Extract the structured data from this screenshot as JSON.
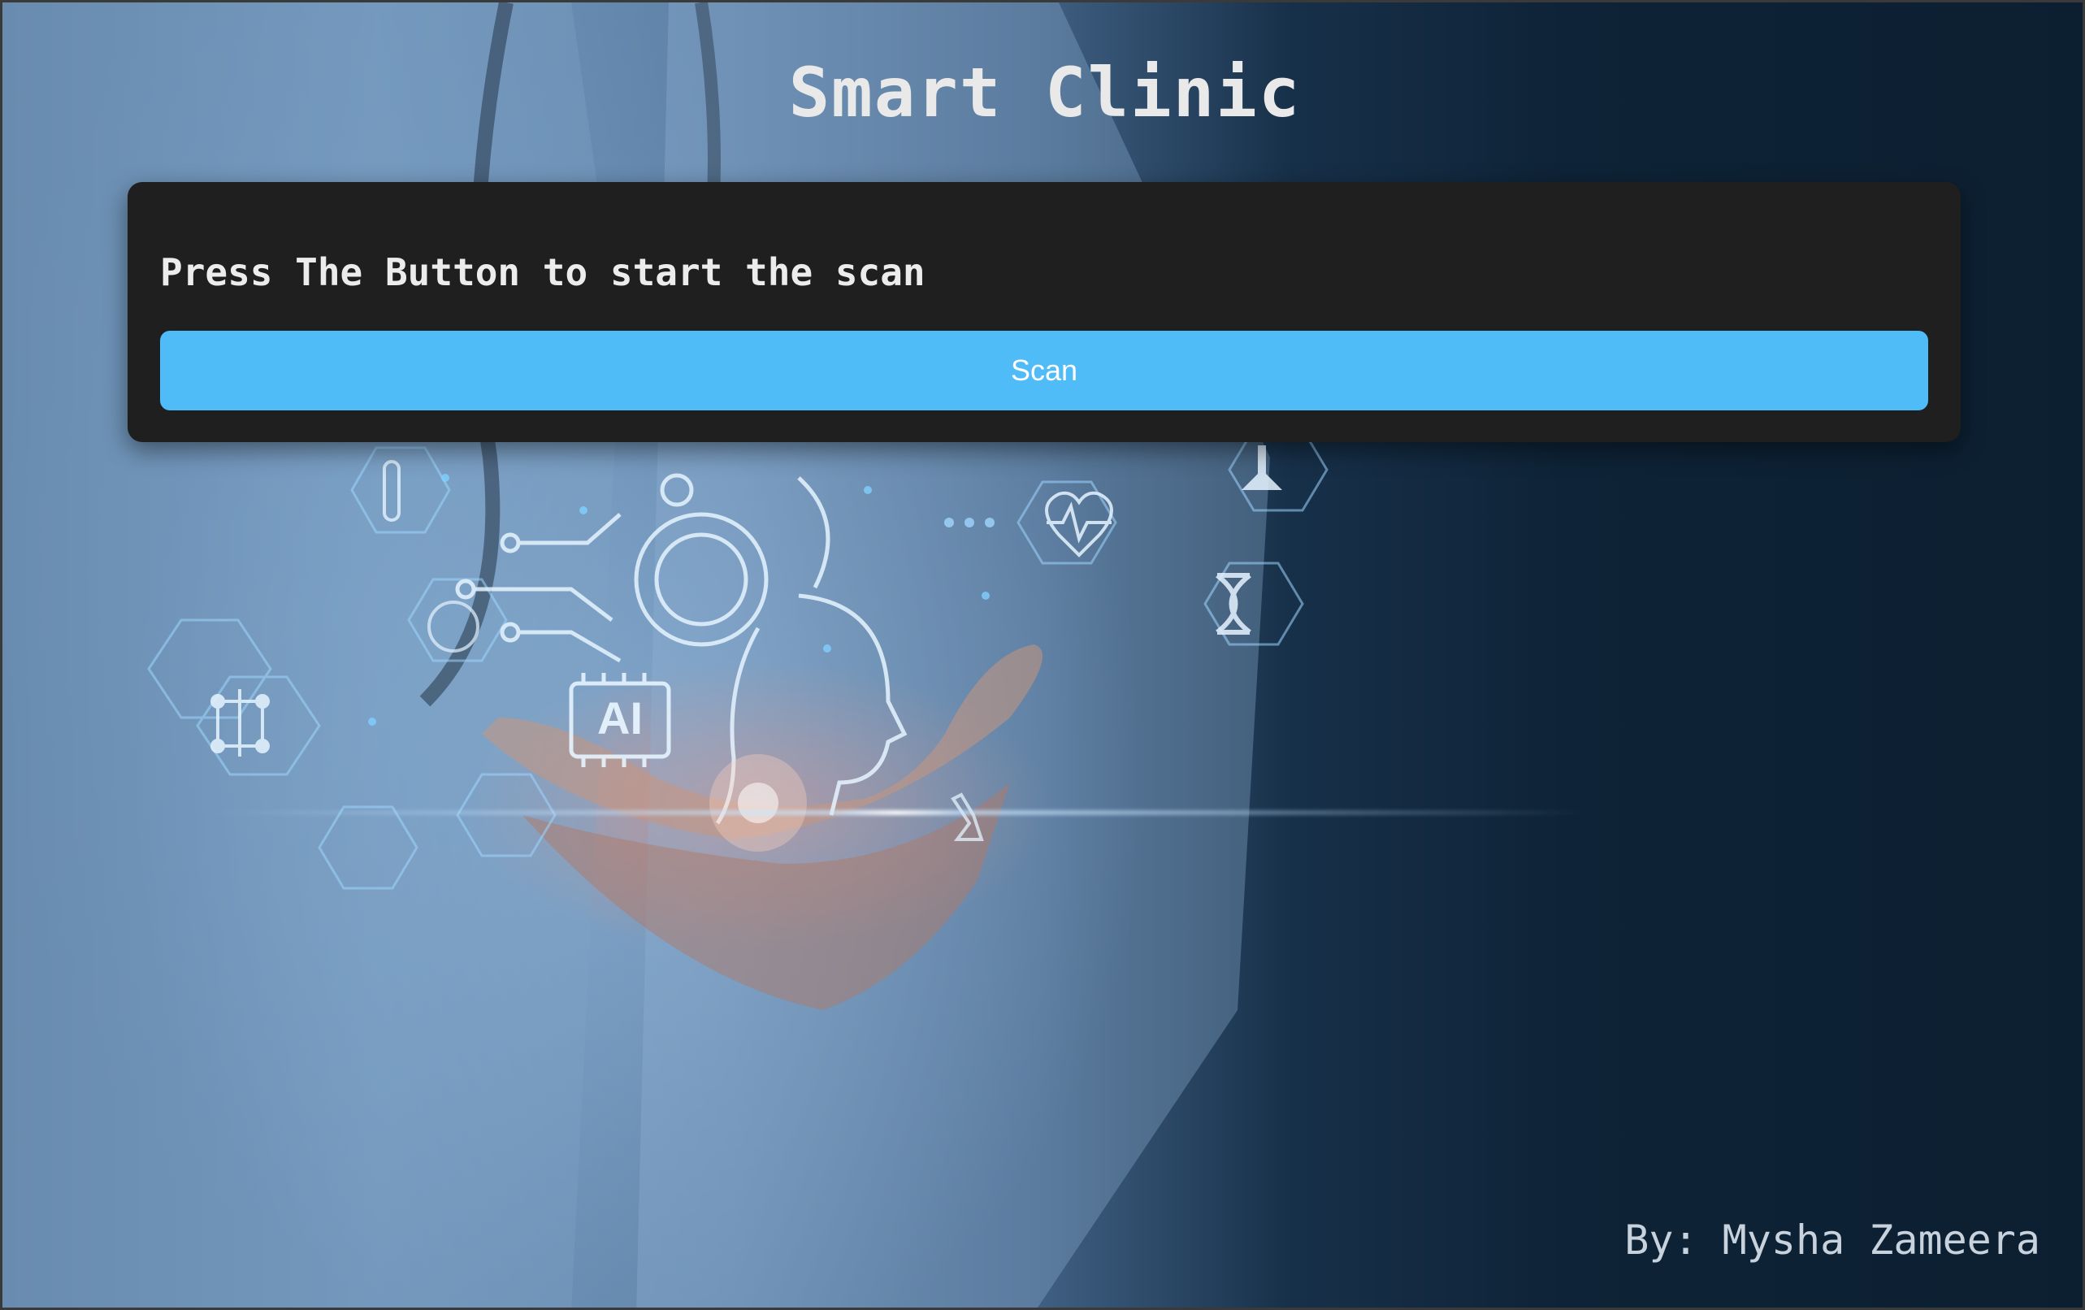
{
  "header": {
    "title": "Smart Clinic"
  },
  "scan_card": {
    "prompt": "Press The Button to start the scan",
    "button_label": "Scan"
  },
  "footer": {
    "author": "By: Mysha Zameera"
  },
  "colors": {
    "button_background": "#4fbcf7",
    "card_background": "#1f1f1f",
    "title_text": "#e9e9e9"
  },
  "background": {
    "description_icons": [
      "test-tube-icon",
      "flask-icon",
      "heart-monitor-icon",
      "dna-icon",
      "brain-icon",
      "ai-chip-icon",
      "gear-icon",
      "molecule-icon",
      "microscope-icon"
    ],
    "ai_chip_text": "AI"
  }
}
